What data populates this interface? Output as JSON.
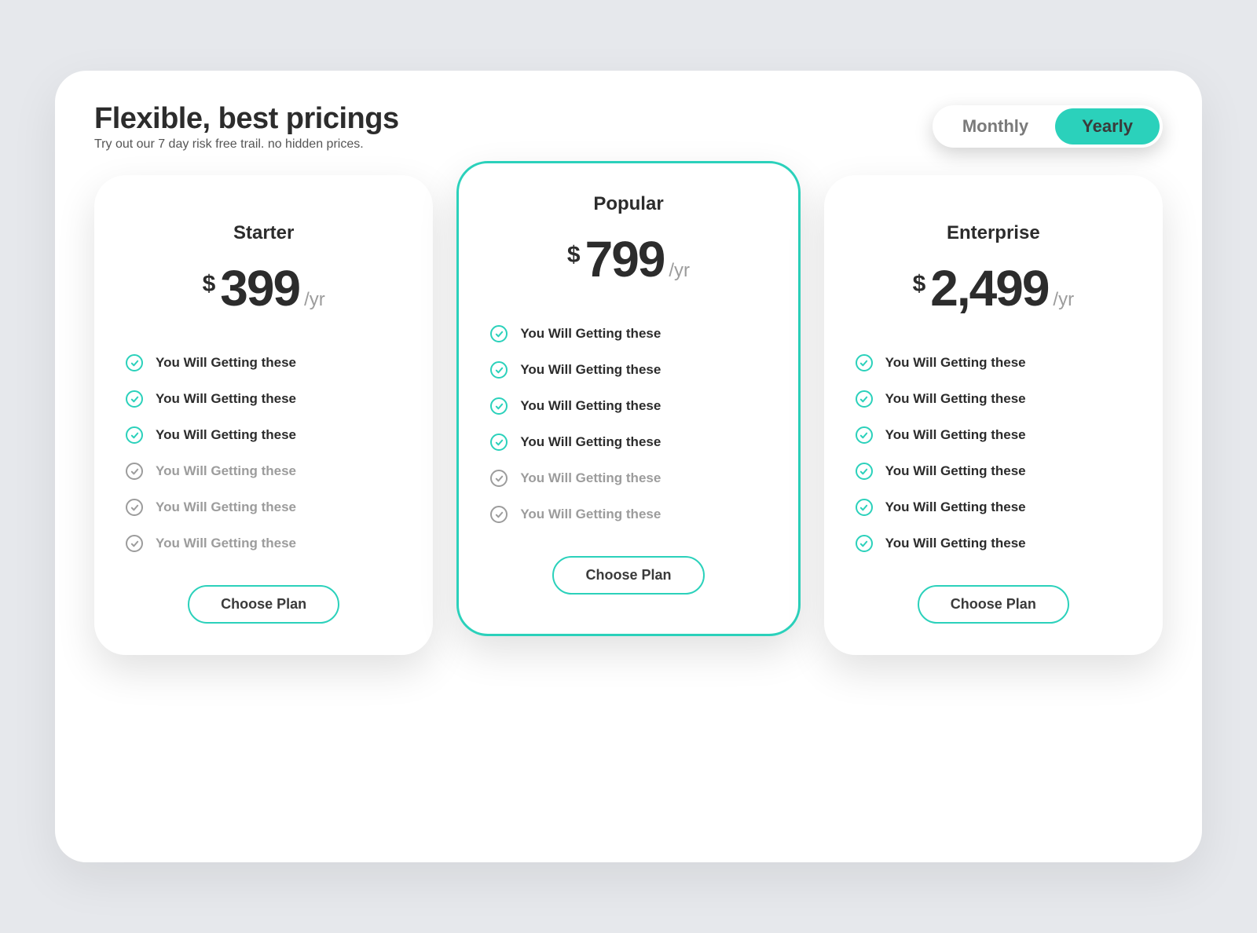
{
  "header": {
    "title": "Flexible, best pricings",
    "subtitle": "Try out our 7 day risk free trail. no hidden prices."
  },
  "toggle": {
    "monthly": "Monthly",
    "yearly": "Yearly",
    "active": "yearly"
  },
  "common": {
    "currency": "$",
    "period": "/yr",
    "cta": "Choose Plan",
    "feature_text": "You Will Getting these"
  },
  "plans": [
    {
      "name": "Starter",
      "price": "399",
      "highlight": false,
      "features": [
        {
          "active": true
        },
        {
          "active": true
        },
        {
          "active": true
        },
        {
          "active": false
        },
        {
          "active": false
        },
        {
          "active": false
        }
      ]
    },
    {
      "name": "Popular",
      "price": "799",
      "highlight": true,
      "features": [
        {
          "active": true
        },
        {
          "active": true
        },
        {
          "active": true
        },
        {
          "active": true
        },
        {
          "active": false
        },
        {
          "active": false
        }
      ]
    },
    {
      "name": "Enterprise",
      "price": "2,499",
      "highlight": false,
      "features": [
        {
          "active": true
        },
        {
          "active": true
        },
        {
          "active": true
        },
        {
          "active": true
        },
        {
          "active": true
        },
        {
          "active": true
        }
      ]
    }
  ]
}
